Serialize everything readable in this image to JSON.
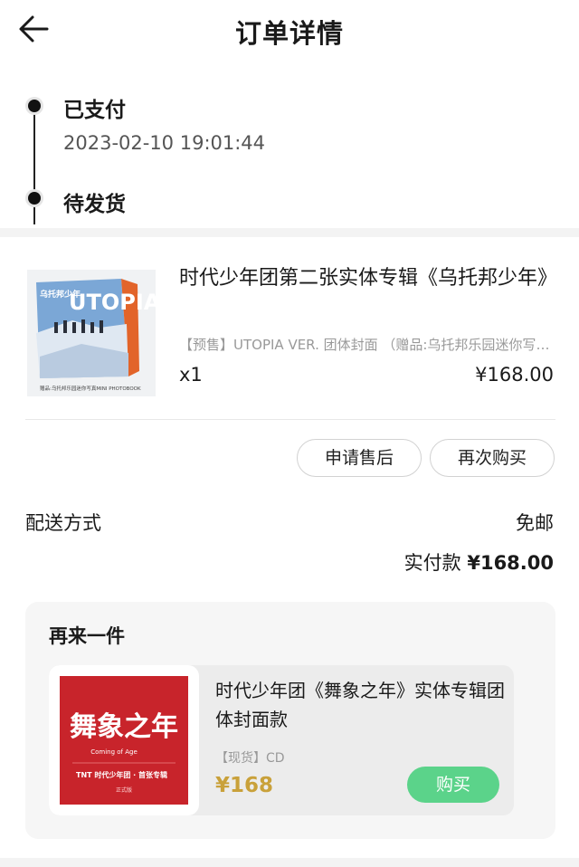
{
  "header": {
    "title": "订单详情",
    "back_icon": "arrow-left-icon"
  },
  "timeline": {
    "status_paid": "已支付",
    "paid_time": "2023-02-10 19:01:44",
    "status_pending": "待发货"
  },
  "product": {
    "name": "时代少年团第二张实体专辑《乌托邦少年》",
    "spec": "【预售】UTOPIA VER. 团体封面 （赠品:乌托邦乐园迷你写真MINI PHOTOBOOK）",
    "qty": "x1",
    "price": "¥168.00",
    "image_cover_text": "UTOPIA",
    "image_side_text": "乌托邦少年",
    "image_caption": "赠品:乌托邦乐园迷你写真MINI PHOTOBOOK"
  },
  "actions": {
    "after_sale": "申请售后",
    "buy_again": "再次购买"
  },
  "delivery": {
    "label": "配送方式",
    "value": "免邮"
  },
  "payment": {
    "label": "实付款",
    "amount": "¥168.00"
  },
  "buy_again_section": {
    "title": "再来一件",
    "item": {
      "name": "时代少年团《舞象之年》实体专辑团体封面款",
      "spec": "【现货】CD",
      "price": "¥168",
      "buy_label": "购买",
      "image_title": "舞象之年",
      "image_subtitle": "Coming of Age",
      "image_label": "TNT 时代少年团 · 首张专辑",
      "image_edition": "正式版"
    }
  },
  "colors": {
    "accent_gold": "#c9a13a",
    "buy_green": "#5bd38a",
    "album_red": "#c8242b"
  }
}
